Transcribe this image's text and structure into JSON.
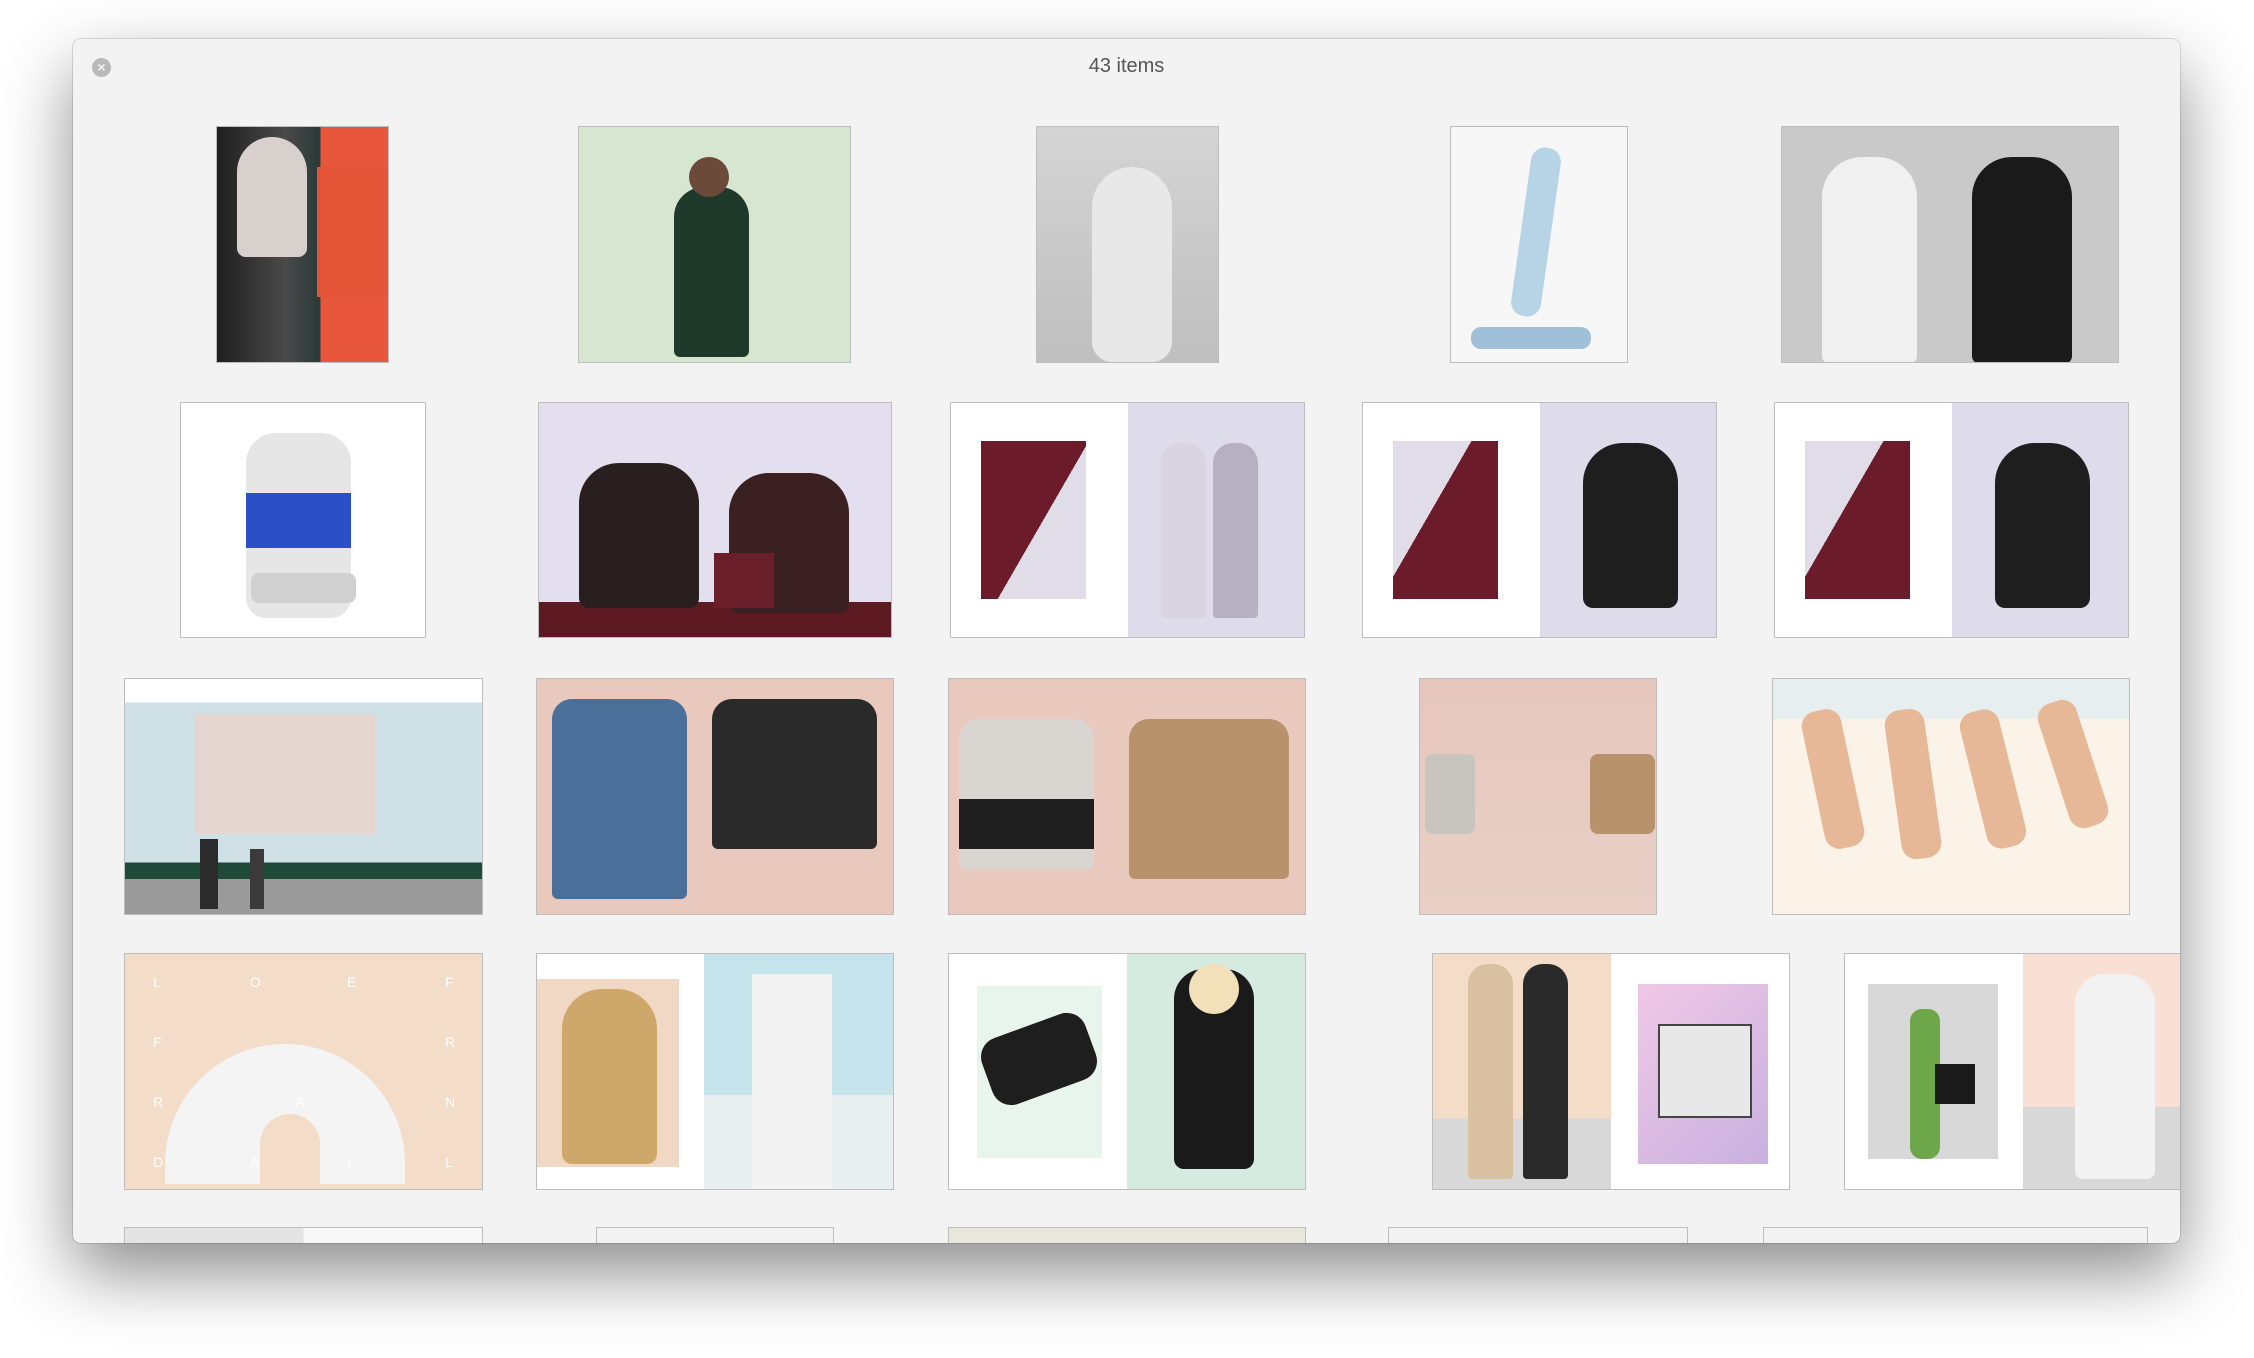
{
  "window": {
    "title": "43 items",
    "close_icon": "close-icon",
    "item_count": 43
  },
  "thumbnails": [
    {
      "label": "photo",
      "bg": "#2f2f2f"
    },
    {
      "label": "photo",
      "bg": "#d7e6d0"
    },
    {
      "label": "photo",
      "bg": "#cfcfcf"
    },
    {
      "label": "photo",
      "bg": "#f7f7f7"
    },
    {
      "label": "photo",
      "bg": "#c9c9c9"
    },
    {
      "label": "photo",
      "bg": "#ffffff"
    },
    {
      "label": "photo",
      "bg": "#e0dcec"
    },
    {
      "label": "photo",
      "bg": "#ffffff"
    },
    {
      "label": "photo",
      "bg": "#ffffff"
    },
    {
      "label": "photo",
      "bg": "#ffffff"
    },
    {
      "label": "photo",
      "bg": "#cfe0e6"
    },
    {
      "label": "photo",
      "bg": "#e9c9bd"
    },
    {
      "label": "photo",
      "bg": "#e9c9bd"
    },
    {
      "label": "photo",
      "bg": "#e6cbc2"
    },
    {
      "label": "photo",
      "bg": "#fbf3e8"
    },
    {
      "label": "photo",
      "bg": "#f3dcc8",
      "letters": "L O E F F E R R A N D A L L"
    },
    {
      "label": "photo",
      "bg": "#ffffff"
    },
    {
      "label": "photo",
      "bg": "#ffffff"
    },
    {
      "label": "photo",
      "bg": "#f3dcc8"
    },
    {
      "label": "photo",
      "bg": "#ffffff"
    }
  ]
}
